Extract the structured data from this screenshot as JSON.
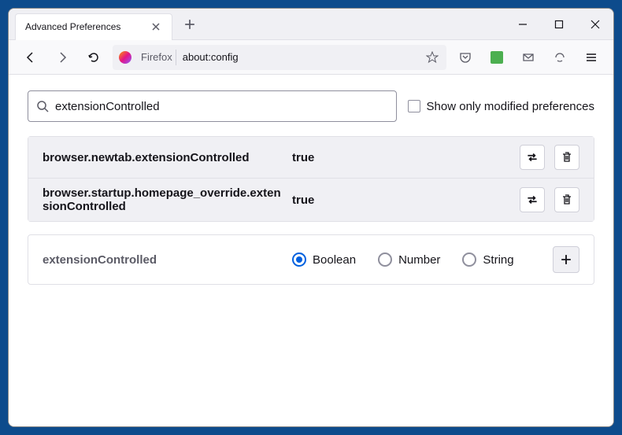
{
  "window": {
    "tab_title": "Advanced Preferences",
    "url_identity": "Firefox",
    "url": "about:config"
  },
  "search": {
    "value": "extensionControlled",
    "checkbox_label": "Show only modified preferences"
  },
  "prefs": [
    {
      "name": "browser.newtab.extensionControlled",
      "value": "true"
    },
    {
      "name": "browser.startup.homepage_override.extensionControlled",
      "value": "true"
    }
  ],
  "new_pref": {
    "name": "extensionControlled",
    "types": [
      {
        "label": "Boolean",
        "checked": true
      },
      {
        "label": "Number",
        "checked": false
      },
      {
        "label": "String",
        "checked": false
      }
    ]
  }
}
